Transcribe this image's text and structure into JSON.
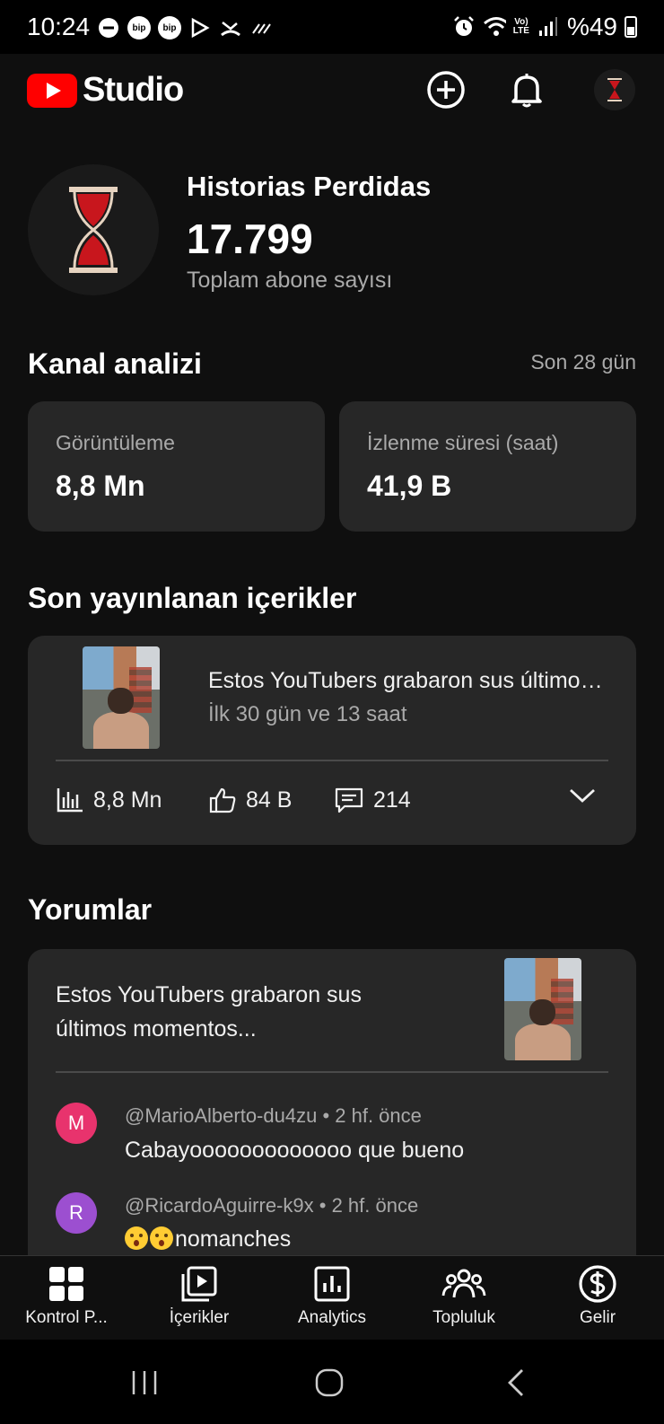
{
  "status_bar": {
    "time": "10:24",
    "battery": "%49",
    "network": "VoLTE",
    "volte_top": "Vo)",
    "volte_bottom": "LTE",
    "app_badge": "bip"
  },
  "header": {
    "brand": "Studio",
    "brand_color": "#ff0000",
    "icons": [
      "create-icon",
      "bell-icon",
      "channel-avatar-icon"
    ]
  },
  "channel": {
    "name": "Historias Perdidas",
    "subscribers": "17.799",
    "subscribers_label": "Toplam abone sayısı"
  },
  "analytics": {
    "title": "Kanal analizi",
    "period": "Son 28 gün",
    "cards": [
      {
        "label": "Görüntüleme",
        "value": "8,8 Mn"
      },
      {
        "label": "İzlenme süresi (saat)",
        "value": "41,9 B"
      }
    ]
  },
  "recent_content": {
    "title": "Son yayınlanan içerikler",
    "video": {
      "title": "Estos YouTubers grabaron sus últimos momentos...",
      "age": "İlk 30 gün ve 13 saat",
      "views": "8,8 Mn",
      "likes": "84 B",
      "comments": "214"
    }
  },
  "comments": {
    "title": "Yorumlar",
    "video_title": "Estos YouTubers grabaron sus últimos momentos...",
    "items": [
      {
        "initial": "M",
        "avatar_color": "#e8336d",
        "author": "@MarioAlberto-du4zu",
        "time": "2 hf. önce",
        "text": "Cabayooooooooooooo que bueno"
      },
      {
        "initial": "R",
        "avatar_color": "#9c4fd0",
        "author": "@RicardoAguirre-k9x",
        "time": "2 hf. önce",
        "text": "nomanches"
      }
    ]
  },
  "bottom_nav": {
    "items": [
      {
        "label": "Kontrol P...",
        "icon": "dashboard-icon"
      },
      {
        "label": "İçerikler",
        "icon": "content-icon"
      },
      {
        "label": "Analytics",
        "icon": "analytics-icon"
      },
      {
        "label": "Topluluk",
        "icon": "community-icon"
      },
      {
        "label": "Gelir",
        "icon": "earn-icon"
      }
    ]
  }
}
